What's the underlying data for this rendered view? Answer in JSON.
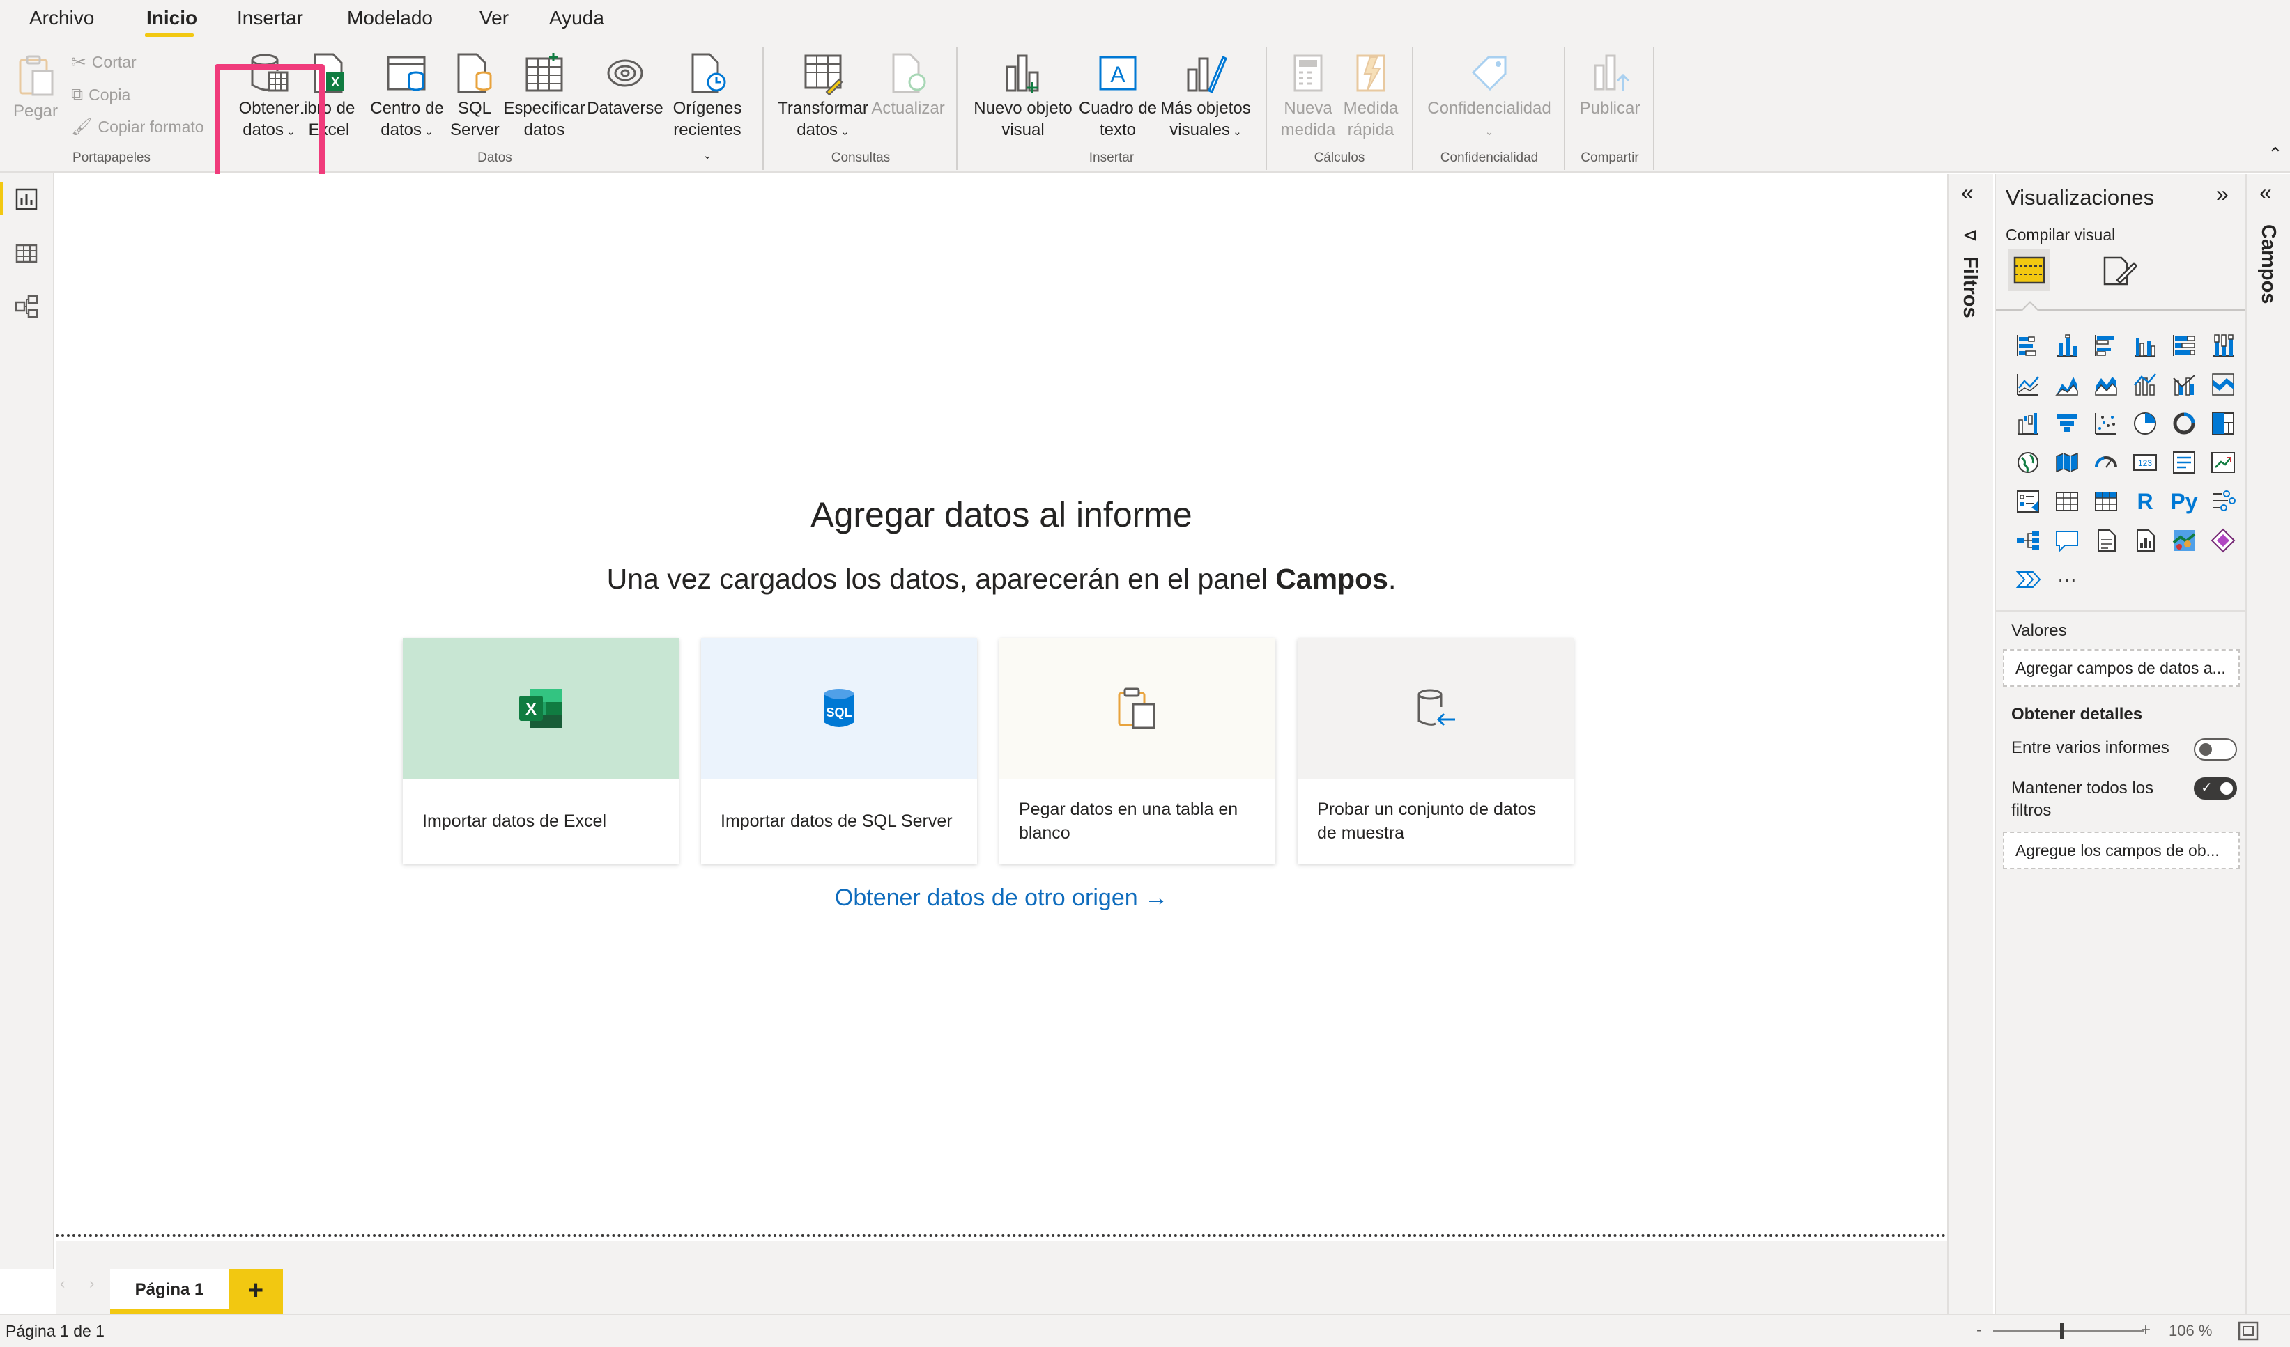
{
  "menu": {
    "items": [
      "Archivo",
      "Inicio",
      "Insertar",
      "Modelado",
      "Ver",
      "Ayuda"
    ],
    "active": "Inicio"
  },
  "ribbon": {
    "clipboard": {
      "paste": "Pegar",
      "cut": "Cortar",
      "copy": "Copia",
      "format_painter": "Copiar formato",
      "group": "Portapapeles"
    },
    "data": {
      "get_data": [
        "Obtener",
        "datos"
      ],
      "excel": [
        "Libro de",
        "Excel"
      ],
      "dataverse_hub": [
        "Centro de",
        "datos"
      ],
      "sql": [
        "SQL",
        "Server"
      ],
      "enter_data": [
        "Especificar",
        "datos"
      ],
      "dataverse": "Dataverse",
      "recent": [
        "Orígenes",
        "recientes"
      ],
      "group": "Datos"
    },
    "queries": {
      "transform": [
        "Transformar",
        "datos"
      ],
      "refresh": "Actualizar",
      "group": "Consultas"
    },
    "insert": {
      "new_visual": [
        "Nuevo objeto",
        "visual"
      ],
      "text_box": [
        "Cuadro de",
        "texto"
      ],
      "more_visuals": [
        "Más objetos",
        "visuales"
      ],
      "group": "Insertar"
    },
    "calculations": {
      "new_measure": [
        "Nueva",
        "medida"
      ],
      "quick_measure": [
        "Medida",
        "rápida"
      ],
      "group": "Cálculos"
    },
    "sensitivity": {
      "label": "Confidencialidad",
      "group": "Confidencialidad"
    },
    "share": {
      "publish": "Publicar",
      "group": "Compartir"
    }
  },
  "canvas": {
    "title": "Agregar datos al informe",
    "subtitle_prefix": "Una vez cargados los datos, aparecerán en el panel ",
    "subtitle_bold": "Campos",
    "subtitle_suffix": ".",
    "cards": [
      {
        "label": "Importar datos de Excel",
        "icon": "excel-icon",
        "bg": "#c8e6d3"
      },
      {
        "label": "Importar datos de SQL Server",
        "icon": "sql-icon",
        "bg": "#ebf3fc"
      },
      {
        "label": "Pegar datos en una tabla en blanco",
        "icon": "paste-icon",
        "bg": "#fbfaf5"
      },
      {
        "label": "Probar un conjunto de datos de muestra",
        "icon": "sample-data-icon",
        "bg": "#f3f2f1"
      }
    ],
    "other_source_link": "Obtener datos de otro origen →"
  },
  "pages": {
    "tab": "Página 1",
    "add": "+"
  },
  "status": {
    "page_info": "Página 1 de 1",
    "zoom_minus": "-",
    "zoom_plus": "+",
    "zoom": "106 %"
  },
  "filters_pane": {
    "label": "Filtros"
  },
  "viz_pane": {
    "title": "Visualizaciones",
    "subtitle": "Compilar visual",
    "values_label": "Valores",
    "values_placeholder": "Agregar campos de datos a...",
    "drillthrough_label": "Obtener detalles",
    "cross_report": "Entre varios informes",
    "keep_filters": "Mantener todos los filtros",
    "drill_placeholder": "Agregue los campos de ob...",
    "r_visual": "R",
    "py_visual": "Py",
    "more": "···"
  },
  "fields_pane": {
    "label": "Campos"
  },
  "colors": {
    "accent": "#f2c811",
    "highlight": "#f03b7b",
    "link": "#0f6cbd",
    "excel": "#107c41",
    "sql": "#0078d4",
    "paste": "#e8a33d"
  }
}
